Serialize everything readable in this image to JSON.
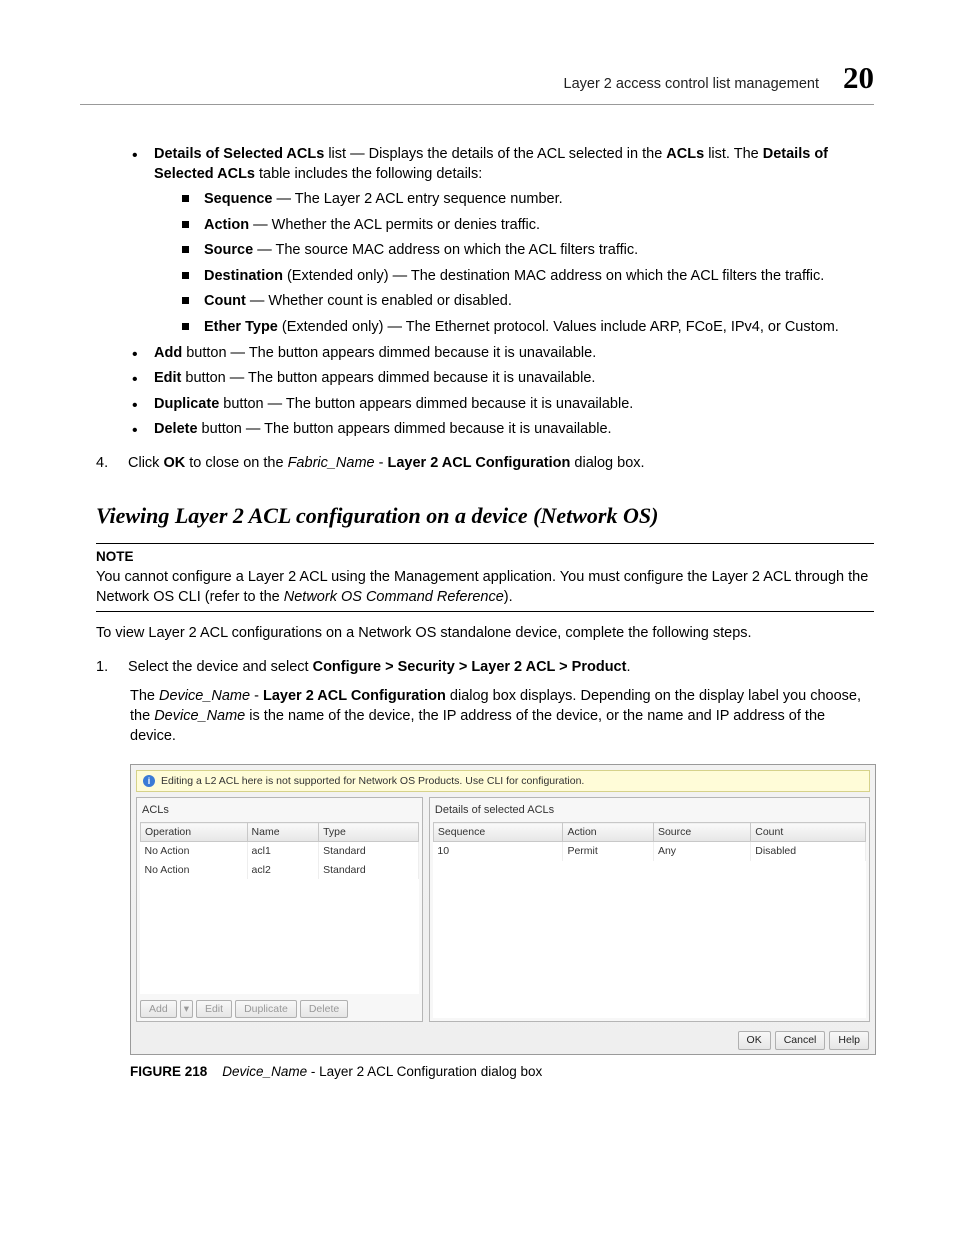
{
  "header": {
    "section": "Layer 2 access control list management",
    "chapter": "20"
  },
  "bullets": {
    "details_intro_a": "Details of Selected ACLs",
    "details_intro_b": " list — Displays the details of the ACL selected in the ",
    "details_intro_c": "ACLs",
    "details_intro_d": " list. The ",
    "details_intro_e": "Details of Selected ACLs",
    "details_intro_f": " table includes the following details:",
    "sub": {
      "sequence_b": "Sequence",
      "sequence_t": " — The Layer 2 ACL entry sequence number.",
      "action_b": "Action",
      "action_t": " — Whether the ACL permits or denies traffic.",
      "source_b": "Source",
      "source_t": " — The source MAC address on which the ACL filters traffic.",
      "dest_b": "Destination",
      "dest_t": " (Extended only) — The destination MAC address on which the ACL filters the traffic.",
      "count_b": "Count",
      "count_t": " — Whether count is enabled or disabled.",
      "ether_b": "Ether Type",
      "ether_t": " (Extended only) — The Ethernet protocol. Values include ARP, FCoE, IPv4, or Custom."
    },
    "add_b": "Add",
    "add_t": " button — The button appears dimmed because it is unavailable.",
    "edit_b": "Edit",
    "edit_t": " button — The button appears dimmed because it is unavailable.",
    "dup_b": "Duplicate",
    "dup_t": " button — The button appears dimmed because it is unavailable.",
    "del_b": "Delete",
    "del_t": " button — The button appears dimmed because it is unavailable."
  },
  "step4": {
    "num": "4.",
    "a": "Click ",
    "b": "OK",
    "c": " to close on the ",
    "d": "Fabric_Name",
    "e": " - ",
    "f": "Layer 2 ACL Configuration",
    "g": " dialog box."
  },
  "h2": "Viewing Layer 2 ACL configuration on a device (Network OS)",
  "note": {
    "label": "NOTE",
    "a": "You cannot configure a Layer 2 ACL using the Management application. You must configure the Layer 2 ACL through the Network OS CLI (refer to the ",
    "b": "Network OS Command Reference",
    "c": ")."
  },
  "para_view": "To view Layer 2 ACL configurations on a Network OS standalone device, complete the following steps.",
  "step1": {
    "num": "1.",
    "a": "Select the device and select ",
    "b": "Configure > Security > Layer 2 ACL > Product",
    "c": ".",
    "sub_a": "The ",
    "sub_b": "Device_Name",
    "sub_c": " - ",
    "sub_d": "Layer 2 ACL Configuration",
    "sub_e": " dialog box displays. Depending on the display label you choose, the ",
    "sub_f": "Device_Name",
    "sub_g": " is the name of the device, the IP address of the device, or the name and IP address of the device."
  },
  "dialog": {
    "info": "Editing a L2 ACL here is not supported for Network OS Products. Use CLI for configuration.",
    "left_title": "ACLs",
    "right_title": "Details of selected ACLs",
    "left_cols": [
      "Operation",
      "Name",
      "Type"
    ],
    "left_rows": [
      [
        "No Action",
        "acl1",
        "Standard"
      ],
      [
        "No Action",
        "acl2",
        "Standard"
      ]
    ],
    "right_cols": [
      "Sequence",
      "Action",
      "Source",
      "Count"
    ],
    "right_rows": [
      [
        "10",
        "Permit",
        "Any",
        "Disabled"
      ]
    ],
    "btn_add": "Add",
    "btn_drop": "▾",
    "btn_edit": "Edit",
    "btn_dup": "Duplicate",
    "btn_del": "Delete",
    "btn_ok": "OK",
    "btn_cancel": "Cancel",
    "btn_help": "Help"
  },
  "figure": {
    "label": "FIGURE 218",
    "name": "Device_Name",
    "rest": " - Layer 2 ACL Configuration dialog box"
  }
}
